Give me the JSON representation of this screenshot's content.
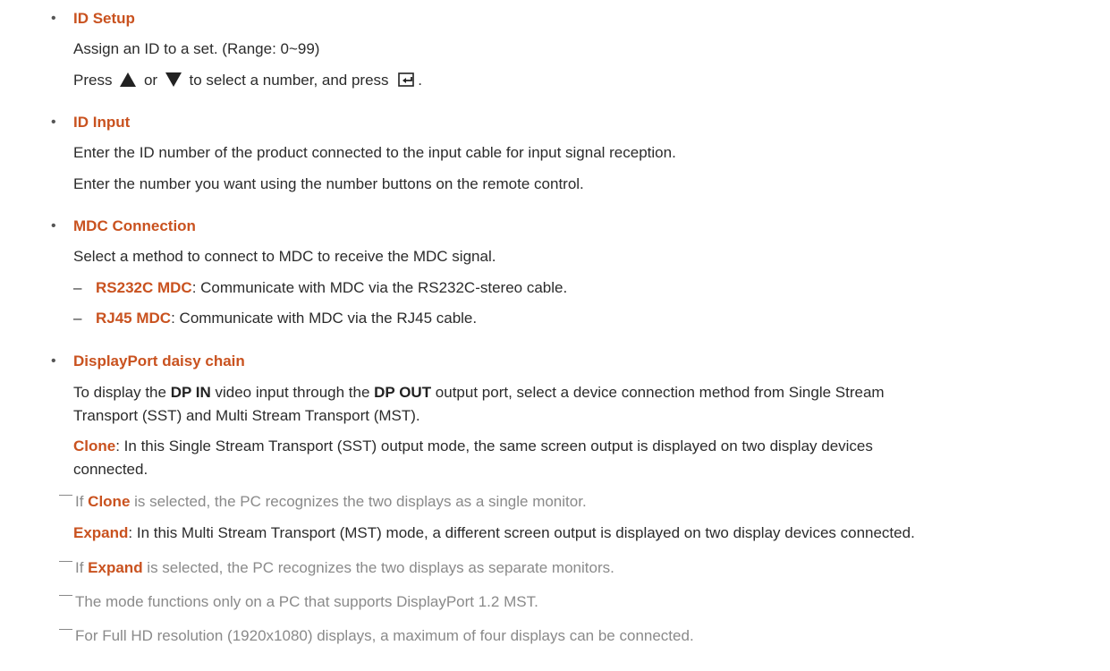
{
  "sections": {
    "id_setup": {
      "title": "ID Setup",
      "line1": "Assign an ID to a set. (Range: 0~99)",
      "line2_a": "Press",
      "line2_or": "or",
      "line2_b": "to select a number, and press",
      "line2_end": "."
    },
    "id_input": {
      "title": "ID Input",
      "line1": "Enter the ID number of the product connected to the input cable for input signal reception.",
      "line2": "Enter the number you want using the number buttons on the remote control."
    },
    "mdc": {
      "title": "MDC Connection",
      "line1": "Select a method to connect to MDC to receive the MDC signal.",
      "items": [
        {
          "name": "RS232C MDC",
          "text": ": Communicate with MDC via the RS232C-stereo cable."
        },
        {
          "name": "RJ45 MDC",
          "text": ": Communicate with MDC via the RJ45 cable."
        }
      ]
    },
    "dp": {
      "title": "DisplayPort daisy chain",
      "p1_a": "To display the ",
      "p1_b1": "DP IN",
      "p1_c": " video input through the ",
      "p1_b2": "DP OUT",
      "p1_d": " output port, select a device connection method from Single Stream",
      "p1_line2": "Transport (SST) and Multi Stream Transport (MST).",
      "clone_label": "Clone",
      "clone_text": ": In this Single Stream Transport (SST) output mode, the same screen output is displayed on two display devices",
      "clone_text2": "connected.",
      "note_clone_a": "If ",
      "note_clone_b": "Clone",
      "note_clone_c": " is selected, the PC recognizes the two displays as a single monitor.",
      "expand_label": "Expand",
      "expand_text": ": In this Multi Stream Transport (MST) mode, a different screen output is displayed on two display devices connected.",
      "note_expand_a": "If ",
      "note_expand_b": "Expand",
      "note_expand_c": " is selected, the PC recognizes the two displays as separate monitors.",
      "note3": "The mode functions only on a PC that supports DisplayPort 1.2 MST.",
      "note4": "For Full HD resolution (1920x1080) displays, a maximum of four displays can be connected."
    }
  },
  "icons": [
    "bullet-dot",
    "up-triangle-icon",
    "down-triangle-icon",
    "enter-key-icon",
    "dash-marker",
    "note-marker"
  ],
  "colors": {
    "heading": "#c9521f",
    "text": "#2b2b2b",
    "note": "#8a8a8a"
  }
}
